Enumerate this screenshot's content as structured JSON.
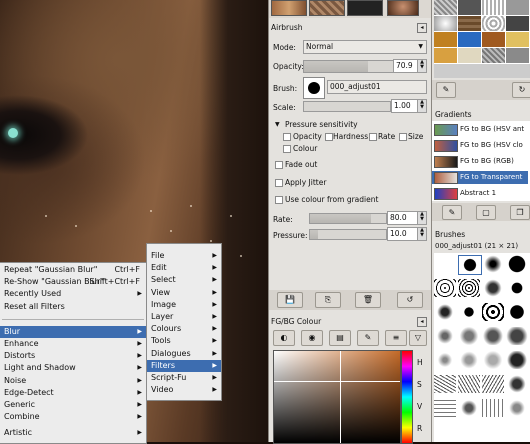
{
  "context_menu": {
    "items": [
      {
        "label": "Repeat \"Gaussian Blur\"",
        "accel": "Ctrl+F"
      },
      {
        "label": "Re-Show \"Gaussian Blur\"",
        "accel": "Shift+Ctrl+F"
      },
      {
        "label": "Recently Used",
        "submenu": true
      },
      {
        "label": "Reset all Filters"
      },
      {
        "label": "Blur",
        "submenu": true,
        "selected": true
      },
      {
        "label": "Enhance",
        "submenu": true
      },
      {
        "label": "Distorts",
        "submenu": true
      },
      {
        "label": "Light and Shadow",
        "submenu": true
      },
      {
        "label": "Noise",
        "submenu": true
      },
      {
        "label": "Edge-Detect",
        "submenu": true
      },
      {
        "label": "Generic",
        "submenu": true
      },
      {
        "label": "Combine",
        "submenu": true
      },
      {
        "label": "Artistic",
        "submenu": true
      }
    ]
  },
  "main_menu": {
    "items": [
      "File",
      "Edit",
      "Select",
      "View",
      "Image",
      "Layer",
      "Colours",
      "Tools",
      "Dialogues",
      "Filters",
      "Script-Fu",
      "Video"
    ],
    "selected": "Filters"
  },
  "airbrush": {
    "title": "Airbrush",
    "mode_label": "Mode:",
    "mode_value": "Normal",
    "opacity_label": "Opacity:",
    "opacity_value": "70.9",
    "opacity_fraction": 0.709,
    "brush_label": "Brush:",
    "brush_name": "000_adjust01",
    "scale_label": "Scale:",
    "scale_value": "1.00",
    "pressure_header": "Pressure sensitivity",
    "pressure_opts": [
      "Opacity",
      "Hardness",
      "Rate",
      "Size",
      "Colour"
    ],
    "fade_out": "Fade out",
    "apply_jitter": "Apply Jitter",
    "use_gradient": "Use colour from gradient",
    "rate_label": "Rate:",
    "rate_value": "80.0",
    "rate_fraction": 0.8,
    "pressure_label": "Pressure:",
    "pressure_value": "10.0",
    "pressure_fraction": 0.1
  },
  "gradients": {
    "title": "Gradients",
    "items": [
      {
        "label": "FG to BG (HSV ant",
        "colors": [
          "#6a9a50",
          "#5a80c0"
        ]
      },
      {
        "label": "FG to BG (HSV clo",
        "colors": [
          "#c06040",
          "#3050a0"
        ]
      },
      {
        "label": "FG to BG (RGB)",
        "colors": [
          "#c08050",
          "#1a1a1a"
        ]
      },
      {
        "label": "FG to Transparent",
        "colors": [
          "#b06040",
          "#e4e2de"
        ],
        "selected": true
      },
      {
        "label": "Abstract 1",
        "colors": [
          "#2040c0",
          "#e04040"
        ]
      }
    ]
  },
  "brushes": {
    "title": "Brushes",
    "current": "000_adjust01 (21 × 21)"
  },
  "fgbg": {
    "title": "FG/BG Colour",
    "fg": "#b87848",
    "bg": "#ffffff"
  },
  "colors": {
    "accent": "#3d6db0"
  }
}
